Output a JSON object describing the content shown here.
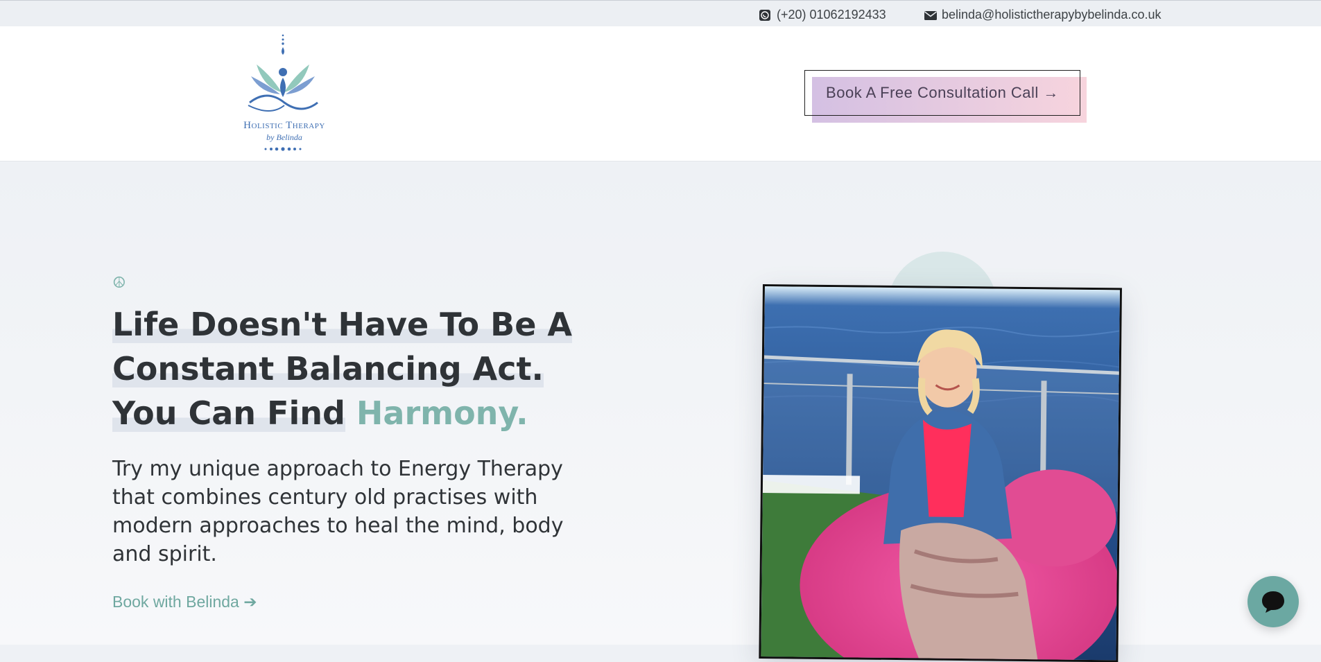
{
  "topbar": {
    "phone": "(+20) 01062192433",
    "email": "belinda@holistictherapybybelinda.co.uk",
    "phone_icon": "whatsapp-icon",
    "email_icon": "envelope-icon"
  },
  "header": {
    "logo_line1": "Holistic Therapy",
    "logo_line2": "by Belinda",
    "cta_label": "Book A Free Consultation Call →"
  },
  "hero": {
    "icon": "peace-icon",
    "headline_line1": "Life Doesn't Have To Be A",
    "headline_line2": "Constant Balancing Act.",
    "headline_line3_prefix": "You Can Find",
    "headline_line3_accent": "Harmony.",
    "subtext": "Try my unique approach to Energy Therapy that combines century old practises with modern approaches to heal the mind, body and spirit.",
    "link_label": "Book with Belinda",
    "link_icon": "arrow-right-icon"
  },
  "chat": {
    "icon": "chat-bubble-icon"
  },
  "colors": {
    "accent": "#7fb4ac",
    "brand_blue": "#3f6fb3",
    "cta_gradient_start": "#d4c0e3",
    "cta_gradient_end": "#f7d4dd"
  }
}
